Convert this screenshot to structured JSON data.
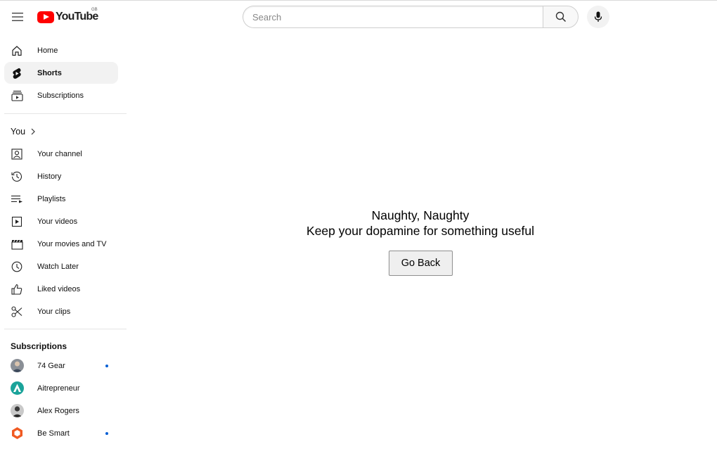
{
  "header": {
    "logo_text": "YouTube",
    "country_code": "GB",
    "search_placeholder": "Search"
  },
  "sidebar": {
    "top_items": [
      {
        "label": "Home",
        "icon": "home-icon"
      },
      {
        "label": "Shorts",
        "icon": "shorts-icon",
        "active": true
      },
      {
        "label": "Subscriptions",
        "icon": "subscriptions-icon"
      }
    ],
    "you": {
      "title": "You",
      "items": [
        {
          "label": "Your channel",
          "icon": "channel-icon"
        },
        {
          "label": "History",
          "icon": "history-icon"
        },
        {
          "label": "Playlists",
          "icon": "playlists-icon"
        },
        {
          "label": "Your videos",
          "icon": "video-icon"
        },
        {
          "label": "Your movies and TV",
          "icon": "movies-icon"
        },
        {
          "label": "Watch Later",
          "icon": "clock-icon"
        },
        {
          "label": "Liked videos",
          "icon": "thumbs-up-icon"
        },
        {
          "label": "Your clips",
          "icon": "scissors-icon"
        }
      ]
    },
    "subscriptions": {
      "title": "Subscriptions",
      "channels": [
        {
          "name": "74 Gear",
          "new_content": true
        },
        {
          "name": "Aitrepreneur",
          "new_content": false
        },
        {
          "name": "Alex Rogers",
          "new_content": false
        },
        {
          "name": "Be Smart",
          "new_content": true
        }
      ]
    }
  },
  "main": {
    "title": "Naughty, Naughty",
    "message": "Keep your dopamine for something useful",
    "button_label": "Go Back"
  },
  "colors": {
    "brand_red": "#ff0000",
    "active_bg": "#f2f2f2",
    "new_dot": "#065fd4"
  }
}
